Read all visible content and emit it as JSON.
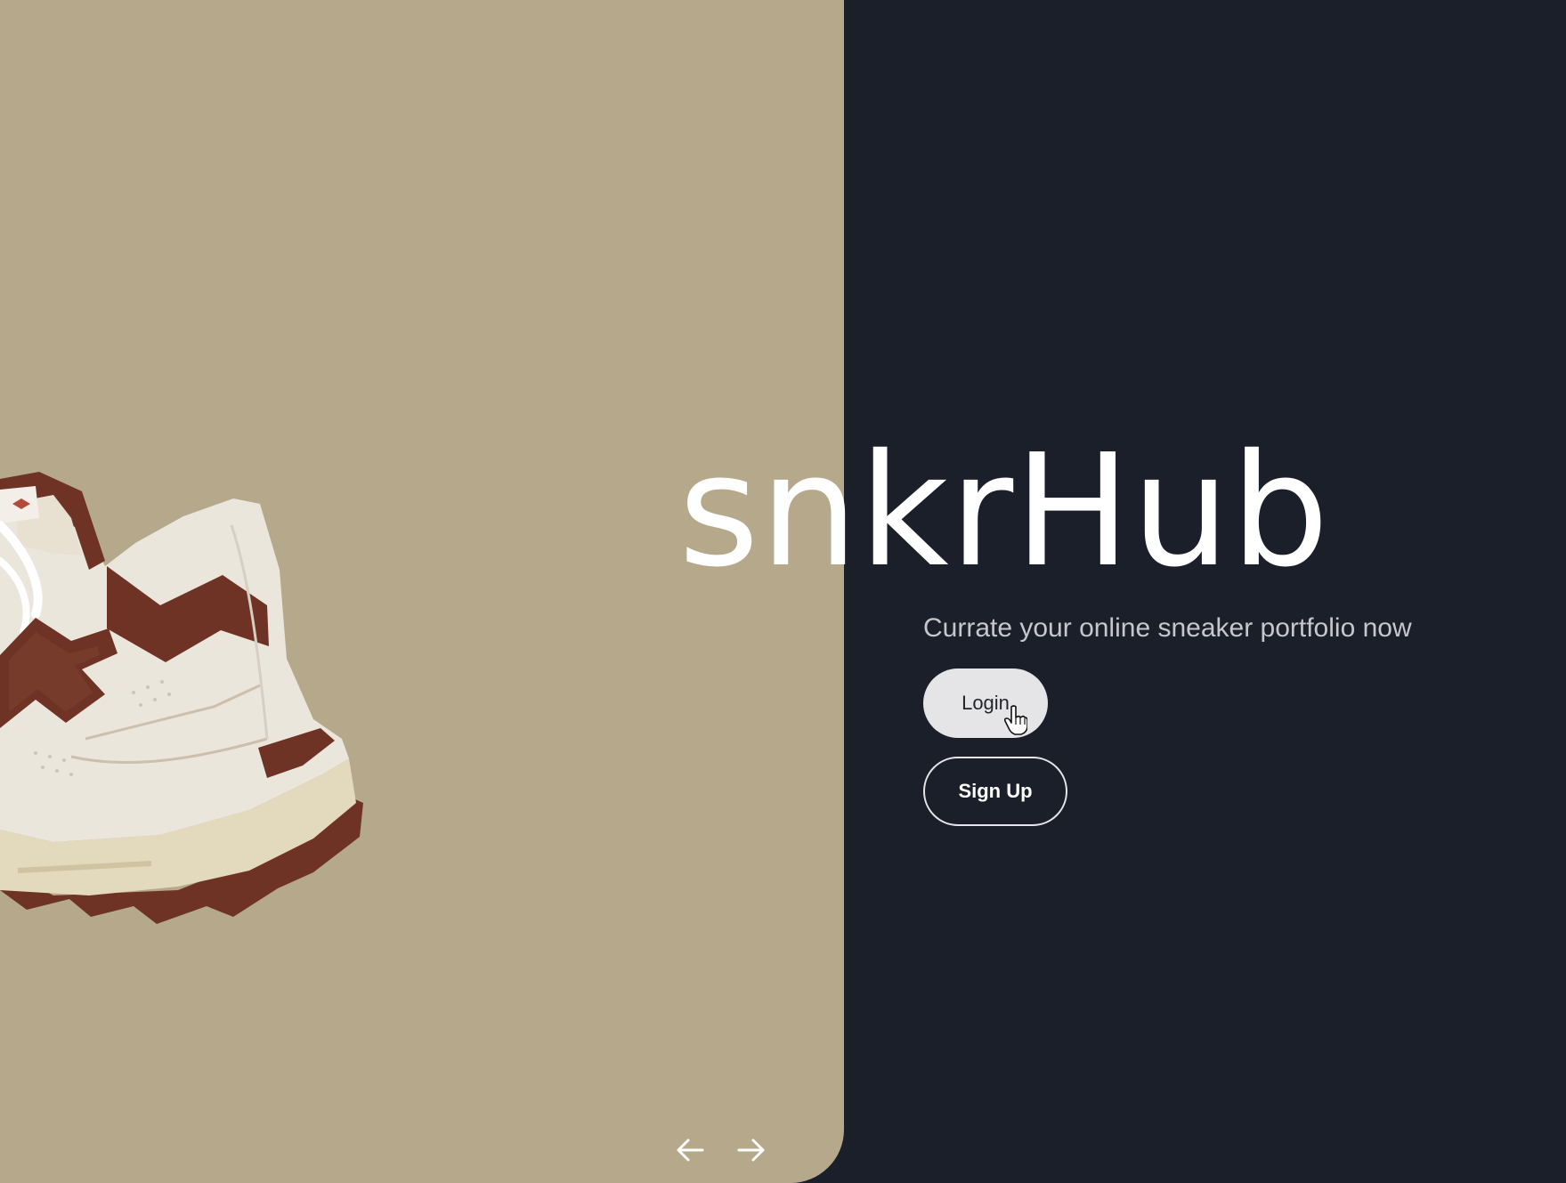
{
  "brand": {
    "title": "snkrHub",
    "tagline": "Currate your online sneaker portfolio now"
  },
  "actions": {
    "login_label": "Login",
    "signup_label": "Sign Up"
  },
  "carousel": {
    "prev_icon": "arrow-left-icon",
    "next_icon": "arrow-right-icon",
    "image": "sneaker-image"
  },
  "colors": {
    "left_panel": "#b5a88b",
    "background": "#1a1f29",
    "login_button": "#e5e5e8",
    "sneaker_leather": "#ebe6dc",
    "sneaker_accent": "#6e3324",
    "sneaker_sole": "#e3d9bd"
  }
}
